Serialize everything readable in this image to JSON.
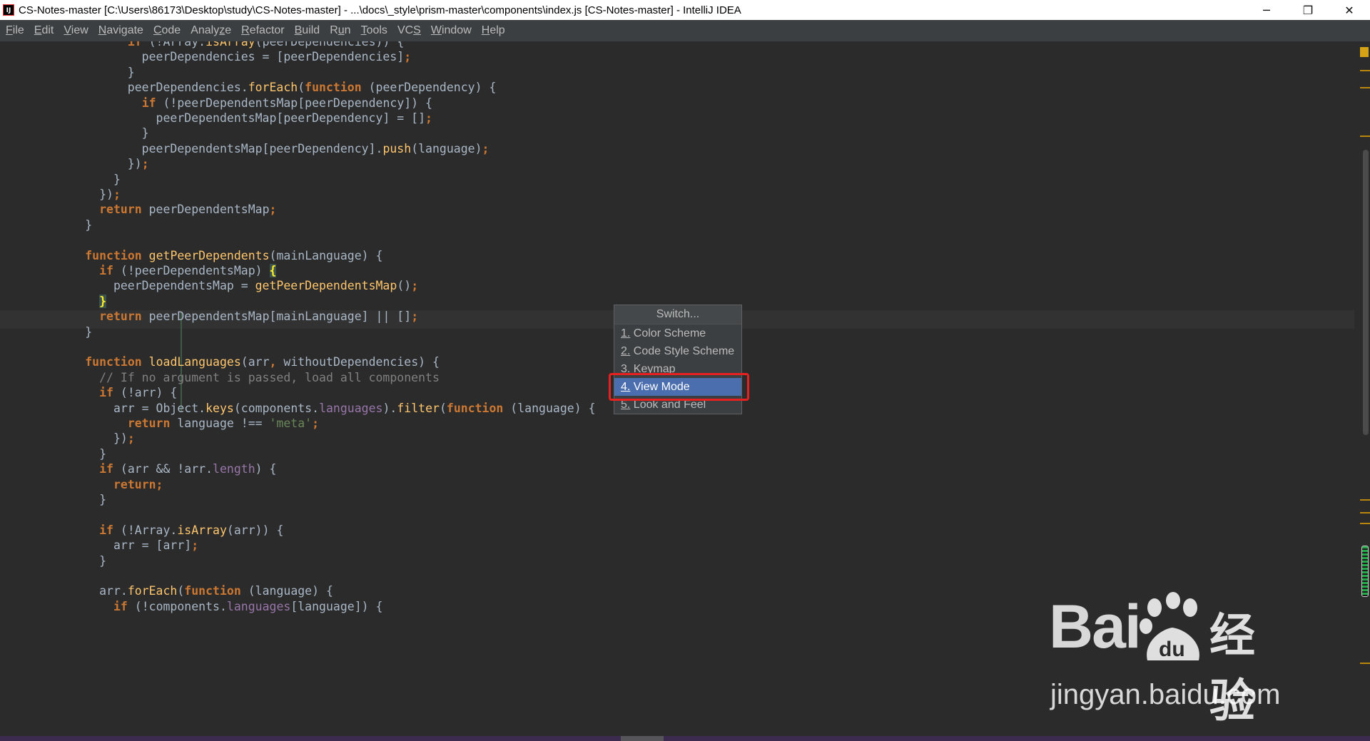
{
  "window": {
    "title": "CS-Notes-master [C:\\Users\\86173\\Desktop\\study\\CS-Notes-master] - ...\\docs\\_style\\prism-master\\components\\index.js [CS-Notes-master] - IntelliJ IDEA",
    "app_icon": "IJ",
    "minimize": "─",
    "restore": "❐",
    "close": "✕"
  },
  "menu": {
    "items": [
      {
        "mn": "F",
        "rest": "ile"
      },
      {
        "mn": "E",
        "rest": "dit"
      },
      {
        "mn": "V",
        "rest": "iew"
      },
      {
        "mn": "N",
        "rest": "avigate"
      },
      {
        "mn": "C",
        "rest": "ode"
      },
      {
        "pre": "Analy",
        "mn": "z",
        "rest": "e"
      },
      {
        "mn": "R",
        "rest": "efactor"
      },
      {
        "mn": "B",
        "rest": "uild"
      },
      {
        "pre": "R",
        "mn": "u",
        "rest": "n"
      },
      {
        "mn": "T",
        "rest": "ools"
      },
      {
        "pre": "VC",
        "mn": "S",
        "rest": ""
      },
      {
        "mn": "W",
        "rest": "indow"
      },
      {
        "mn": "H",
        "rest": "elp"
      }
    ]
  },
  "code": {
    "lines": [
      [
        [
          "                  ",
          ""
        ],
        [
          "if",
          "kw"
        ],
        [
          " (!Array.",
          ""
        ],
        [
          "isArray",
          "fn"
        ],
        [
          "(peerDependencies)) {",
          ""
        ]
      ],
      [
        [
          "                    peerDependencies = [peerDependencies]",
          ""
        ],
        [
          ";",
          "kw"
        ]
      ],
      [
        [
          "                  }",
          ""
        ]
      ],
      [
        [
          "                  peerDependencies.",
          ""
        ],
        [
          "forEach",
          "fn"
        ],
        [
          "(",
          ""
        ],
        [
          "function",
          "kw"
        ],
        [
          " (peerDependency) {",
          ""
        ]
      ],
      [
        [
          "                    ",
          ""
        ],
        [
          "if",
          "kw"
        ],
        [
          " (!peerDependentsMap[peerDependency]) {",
          ""
        ]
      ],
      [
        [
          "                      peerDependentsMap[peerDependency] = []",
          ""
        ],
        [
          ";",
          "kw"
        ]
      ],
      [
        [
          "                    }",
          ""
        ]
      ],
      [
        [
          "                    peerDependentsMap[peerDependency].",
          ""
        ],
        [
          "push",
          "fn"
        ],
        [
          "(language)",
          ""
        ],
        [
          ";",
          "kw"
        ]
      ],
      [
        [
          "                  })",
          ""
        ],
        [
          ";",
          "kw"
        ]
      ],
      [
        [
          "                }",
          ""
        ]
      ],
      [
        [
          "              })",
          ""
        ],
        [
          ";",
          "kw"
        ]
      ],
      [
        [
          "              ",
          ""
        ],
        [
          "return",
          "kw"
        ],
        [
          " peerDependentsMap",
          ""
        ],
        [
          ";",
          "kw"
        ]
      ],
      [
        [
          "            }",
          ""
        ]
      ],
      [
        [
          "",
          ""
        ]
      ],
      [
        [
          "            ",
          ""
        ],
        [
          "function",
          "kw"
        ],
        [
          " ",
          ""
        ],
        [
          "getPeerDependents",
          "fn"
        ],
        [
          "(mainLanguage) {",
          ""
        ]
      ],
      [
        [
          "              ",
          ""
        ],
        [
          "if",
          "kw"
        ],
        [
          " (!peerDependentsMap) ",
          ""
        ],
        [
          "{",
          "brace-match"
        ]
      ],
      [
        [
          "                peerDependentsMap = ",
          ""
        ],
        [
          "getPeerDependentsMap",
          "fn"
        ],
        [
          "()",
          ""
        ],
        [
          ";",
          "kw"
        ]
      ],
      [
        [
          "              ",
          ""
        ],
        [
          "}",
          "brace-match"
        ]
      ],
      [
        [
          "              ",
          ""
        ],
        [
          "return",
          "kw"
        ],
        [
          " peerDependentsMap[mainLanguage] || []",
          ""
        ],
        [
          ";",
          "kw"
        ]
      ],
      [
        [
          "            }",
          ""
        ]
      ],
      [
        [
          "",
          ""
        ]
      ],
      [
        [
          "            ",
          ""
        ],
        [
          "function",
          "kw"
        ],
        [
          " ",
          ""
        ],
        [
          "loadLanguages",
          "fn"
        ],
        [
          "(arr",
          ""
        ],
        [
          ",",
          "kw"
        ],
        [
          " withoutDependencies) {",
          ""
        ]
      ],
      [
        [
          "              ",
          ""
        ],
        [
          "// If no argument is passed, load all components",
          "cmt"
        ]
      ],
      [
        [
          "              ",
          ""
        ],
        [
          "if",
          "kw"
        ],
        [
          " (!arr) {",
          ""
        ]
      ],
      [
        [
          "                arr = Object.",
          ""
        ],
        [
          "keys",
          "fn"
        ],
        [
          "(components.",
          ""
        ],
        [
          "languages",
          "prop"
        ],
        [
          ").",
          ""
        ],
        [
          "filter",
          "fn"
        ],
        [
          "(",
          ""
        ],
        [
          "function",
          "kw"
        ],
        [
          " (language) {",
          ""
        ]
      ],
      [
        [
          "                  ",
          ""
        ],
        [
          "return",
          "kw"
        ],
        [
          " language !== ",
          ""
        ],
        [
          "'meta'",
          "str"
        ],
        [
          ";",
          "kw"
        ]
      ],
      [
        [
          "                })",
          ""
        ],
        [
          ";",
          "kw"
        ]
      ],
      [
        [
          "              }",
          ""
        ]
      ],
      [
        [
          "              ",
          ""
        ],
        [
          "if",
          "kw"
        ],
        [
          " (arr && !arr.",
          ""
        ],
        [
          "length",
          "prop"
        ],
        [
          ") {",
          ""
        ]
      ],
      [
        [
          "                ",
          ""
        ],
        [
          "return;",
          "kw"
        ]
      ],
      [
        [
          "              }",
          ""
        ]
      ],
      [
        [
          "",
          ""
        ]
      ],
      [
        [
          "              ",
          ""
        ],
        [
          "if",
          "kw"
        ],
        [
          " (!Array.",
          ""
        ],
        [
          "isArray",
          "fn"
        ],
        [
          "(arr)) {",
          ""
        ]
      ],
      [
        [
          "                arr = [arr]",
          ""
        ],
        [
          ";",
          "kw"
        ]
      ],
      [
        [
          "              }",
          ""
        ]
      ],
      [
        [
          "",
          ""
        ]
      ],
      [
        [
          "              arr.",
          ""
        ],
        [
          "forEach",
          "fn"
        ],
        [
          "(",
          ""
        ],
        [
          "function",
          "kw"
        ],
        [
          " (language) {",
          ""
        ]
      ],
      [
        [
          "                ",
          ""
        ],
        [
          "if",
          "kw"
        ],
        [
          " (!components.",
          ""
        ],
        [
          "languages",
          "prop"
        ],
        [
          "[language]) {",
          ""
        ]
      ]
    ]
  },
  "popup": {
    "title": "Switch...",
    "items": [
      {
        "num": "1",
        "label": " Color Scheme",
        "selected": false
      },
      {
        "num": "2",
        "label": " Code Style Scheme",
        "selected": false
      },
      {
        "num": "3",
        "label": " Keymap",
        "selected": false
      },
      {
        "num": "4",
        "label": " View Mode",
        "selected": true
      },
      {
        "num": "5",
        "label": " Look and Feel",
        "selected": false
      }
    ]
  },
  "watermark": {
    "logo": "Bai",
    "logo_tail": "du",
    "cn": "经验",
    "url": "jingyan.baidu.com"
  }
}
